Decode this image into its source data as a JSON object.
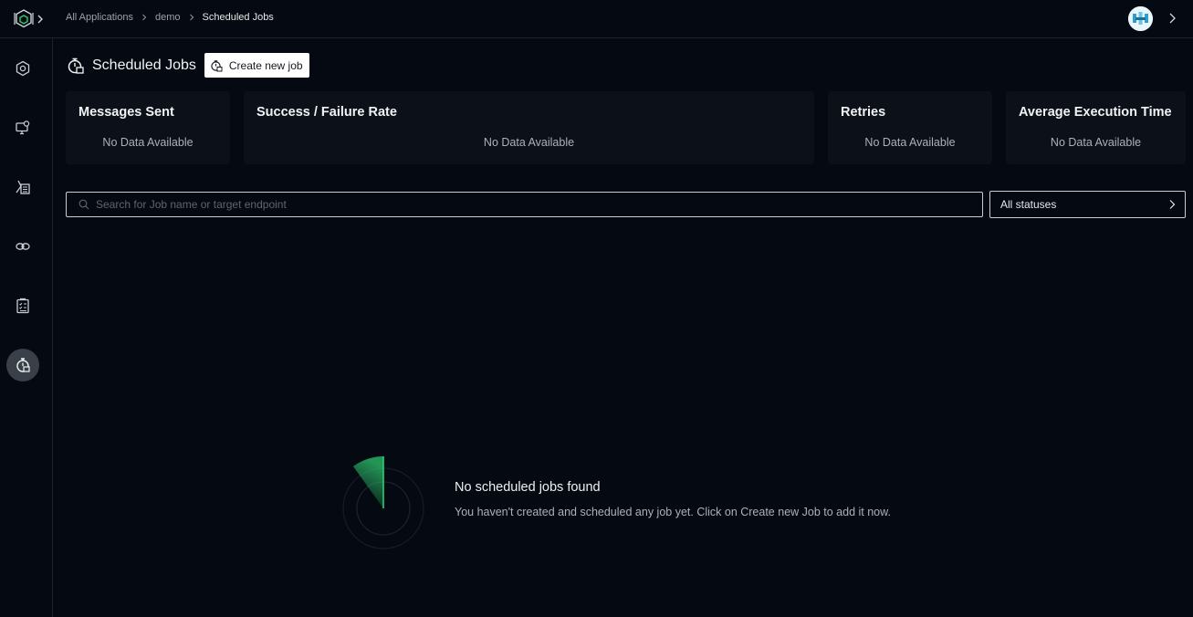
{
  "colors": {
    "background": "#050a12",
    "card_background": "#0c1119",
    "accent": "#2ecc71",
    "active_nav": "#3a4049"
  },
  "breadcrumb": [
    {
      "label": "All Applications"
    },
    {
      "label": "demo"
    },
    {
      "label": "Scheduled Jobs"
    }
  ],
  "header": {
    "user_avatar_icon": "avatar-icon",
    "expand_icon": "chevron-right-icon"
  },
  "sidebar": {
    "items": [
      {
        "name": "cube-hex-icon",
        "active": false
      },
      {
        "name": "monitor-gear-icon",
        "active": false
      },
      {
        "name": "document-list-icon",
        "active": false
      },
      {
        "name": "links-icon",
        "active": false
      },
      {
        "name": "clipboard-checklist-icon",
        "active": false
      },
      {
        "name": "stopwatch-icon",
        "active": true
      }
    ]
  },
  "page": {
    "title": "Scheduled Jobs",
    "create_button_label": "Create new job"
  },
  "stats": [
    {
      "title": "Messages Sent",
      "value": "No Data Available"
    },
    {
      "title": "Success / Failure Rate",
      "value": "No Data Available"
    },
    {
      "title": "Retries",
      "value": "No Data Available"
    },
    {
      "title": "Average Execution Time",
      "value": "No Data Available"
    }
  ],
  "search": {
    "placeholder": "Search for Job name or target endpoint",
    "value": ""
  },
  "status_filter": {
    "selected": "All statuses"
  },
  "empty_state": {
    "title": "No scheduled jobs found",
    "description": "You haven't created and scheduled any job yet. Click on Create new Job to add it now."
  }
}
